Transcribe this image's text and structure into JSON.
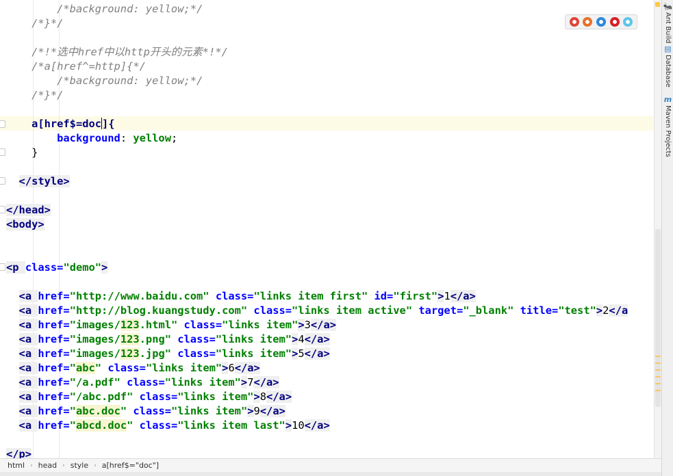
{
  "editor": {
    "lines": [
      [
        {
          "t": "        "
        },
        {
          "t": "/*background: yellow;*/",
          "c": "cm"
        }
      ],
      [
        {
          "t": "    "
        },
        {
          "t": "/*}*/",
          "c": "cm"
        }
      ],
      [],
      [
        {
          "t": "    "
        },
        {
          "t": "/*!*选中href中以http开头的元素*!*/",
          "c": "cm"
        }
      ],
      [
        {
          "t": "    "
        },
        {
          "t": "/*a[href^=http]{*/",
          "c": "cm"
        }
      ],
      [
        {
          "t": "        "
        },
        {
          "t": "/*background: yellow;*/",
          "c": "cm"
        }
      ],
      [
        {
          "t": "    "
        },
        {
          "t": "/*}*/",
          "c": "cm"
        }
      ],
      [],
      [
        {
          "t": "    "
        },
        {
          "t": "a[href$=doc",
          "c": "sel"
        },
        {
          "t": "|",
          "c": "caret"
        },
        {
          "t": "]{",
          "c": "sel"
        }
      ],
      [
        {
          "t": "        "
        },
        {
          "t": "background",
          "c": "pn"
        },
        {
          "t": ": "
        },
        {
          "t": "yellow",
          "c": "pv"
        },
        {
          "t": ";"
        }
      ],
      [
        {
          "t": "    "
        },
        {
          "t": "}"
        }
      ],
      [],
      [
        {
          "t": "  "
        },
        {
          "t": "</style>",
          "c": "tg"
        }
      ],
      [],
      [
        {
          "t": "</head>",
          "c": "tg"
        }
      ],
      [
        {
          "t": "<body>",
          "c": "tg"
        }
      ],
      [],
      [],
      [
        {
          "t": "<p ",
          "c": "tg"
        },
        {
          "t": "class",
          "c": "an"
        },
        {
          "t": "=",
          "c": "an"
        },
        {
          "t": "\"demo\"",
          "c": "av"
        },
        {
          "t": ">",
          "c": "tg"
        }
      ],
      [],
      [
        {
          "t": "  "
        },
        {
          "t": "<a ",
          "c": "tg"
        },
        {
          "t": "href=",
          "c": "an"
        },
        {
          "t": "\"http://www.baidu.com\"",
          "c": "av"
        },
        {
          "t": " class=",
          "c": "an"
        },
        {
          "t": "\"links item first\"",
          "c": "av"
        },
        {
          "t": " id=",
          "c": "an"
        },
        {
          "t": "\"first\"",
          "c": "av"
        },
        {
          "t": ">",
          "c": "tg"
        },
        {
          "t": "1"
        },
        {
          "t": "</a>",
          "c": "tg"
        }
      ],
      [
        {
          "t": "  "
        },
        {
          "t": "<a ",
          "c": "tg"
        },
        {
          "t": "href=",
          "c": "an"
        },
        {
          "t": "\"http://blog.kuangstudy.com\"",
          "c": "av"
        },
        {
          "t": " class=",
          "c": "an"
        },
        {
          "t": "\"links item active\"",
          "c": "av"
        },
        {
          "t": " target=",
          "c": "an"
        },
        {
          "t": "\"_blank\"",
          "c": "av"
        },
        {
          "t": " title=",
          "c": "an"
        },
        {
          "t": "\"test\"",
          "c": "av"
        },
        {
          "t": ">",
          "c": "tg"
        },
        {
          "t": "2"
        },
        {
          "t": "</a",
          "c": "tg"
        }
      ],
      [
        {
          "t": "  "
        },
        {
          "t": "<a ",
          "c": "tg"
        },
        {
          "t": "href=",
          "c": "an"
        },
        {
          "t": "\"images/",
          "c": "av"
        },
        {
          "t": "123",
          "c": "av hl"
        },
        {
          "t": ".html\"",
          "c": "av"
        },
        {
          "t": " class=",
          "c": "an"
        },
        {
          "t": "\"links item\"",
          "c": "av"
        },
        {
          "t": ">",
          "c": "tg"
        },
        {
          "t": "3"
        },
        {
          "t": "</a>",
          "c": "tg"
        }
      ],
      [
        {
          "t": "  "
        },
        {
          "t": "<a ",
          "c": "tg"
        },
        {
          "t": "href=",
          "c": "an"
        },
        {
          "t": "\"images/",
          "c": "av"
        },
        {
          "t": "123",
          "c": "av hl"
        },
        {
          "t": ".png\"",
          "c": "av"
        },
        {
          "t": " class=",
          "c": "an"
        },
        {
          "t": "\"links item\"",
          "c": "av"
        },
        {
          "t": ">",
          "c": "tg"
        },
        {
          "t": "4"
        },
        {
          "t": "</a>",
          "c": "tg"
        }
      ],
      [
        {
          "t": "  "
        },
        {
          "t": "<a ",
          "c": "tg"
        },
        {
          "t": "href=",
          "c": "an"
        },
        {
          "t": "\"images/",
          "c": "av"
        },
        {
          "t": "123",
          "c": "av hl"
        },
        {
          "t": ".jpg\"",
          "c": "av"
        },
        {
          "t": " class=",
          "c": "an"
        },
        {
          "t": "\"links item\"",
          "c": "av"
        },
        {
          "t": ">",
          "c": "tg"
        },
        {
          "t": "5"
        },
        {
          "t": "</a>",
          "c": "tg"
        }
      ],
      [
        {
          "t": "  "
        },
        {
          "t": "<a ",
          "c": "tg"
        },
        {
          "t": "href=",
          "c": "an"
        },
        {
          "t": "\"",
          "c": "av"
        },
        {
          "t": "abc",
          "c": "av hl"
        },
        {
          "t": "\"",
          "c": "av"
        },
        {
          "t": " class=",
          "c": "an"
        },
        {
          "t": "\"links item\"",
          "c": "av"
        },
        {
          "t": ">",
          "c": "tg"
        },
        {
          "t": "6"
        },
        {
          "t": "</a>",
          "c": "tg"
        }
      ],
      [
        {
          "t": "  "
        },
        {
          "t": "<a ",
          "c": "tg"
        },
        {
          "t": "href=",
          "c": "an"
        },
        {
          "t": "\"/a.pdf\"",
          "c": "av"
        },
        {
          "t": " class=",
          "c": "an"
        },
        {
          "t": "\"links item\"",
          "c": "av"
        },
        {
          "t": ">",
          "c": "tg"
        },
        {
          "t": "7"
        },
        {
          "t": "</a>",
          "c": "tg"
        }
      ],
      [
        {
          "t": "  "
        },
        {
          "t": "<a ",
          "c": "tg"
        },
        {
          "t": "href=",
          "c": "an"
        },
        {
          "t": "\"/abc.pdf\"",
          "c": "av"
        },
        {
          "t": " class=",
          "c": "an"
        },
        {
          "t": "\"links item\"",
          "c": "av"
        },
        {
          "t": ">",
          "c": "tg"
        },
        {
          "t": "8"
        },
        {
          "t": "</a>",
          "c": "tg"
        }
      ],
      [
        {
          "t": "  "
        },
        {
          "t": "<a ",
          "c": "tg"
        },
        {
          "t": "href=",
          "c": "an"
        },
        {
          "t": "\"",
          "c": "av"
        },
        {
          "t": "abc.doc",
          "c": "av hl"
        },
        {
          "t": "\"",
          "c": "av"
        },
        {
          "t": " class=",
          "c": "an"
        },
        {
          "t": "\"links item\"",
          "c": "av"
        },
        {
          "t": ">",
          "c": "tg"
        },
        {
          "t": "9"
        },
        {
          "t": "</a>",
          "c": "tg"
        }
      ],
      [
        {
          "t": "  "
        },
        {
          "t": "<a ",
          "c": "tg"
        },
        {
          "t": "href=",
          "c": "an"
        },
        {
          "t": "\"",
          "c": "av"
        },
        {
          "t": "abcd.doc",
          "c": "av hl"
        },
        {
          "t": "\"",
          "c": "av"
        },
        {
          "t": " class=",
          "c": "an"
        },
        {
          "t": "\"links item last\"",
          "c": "av"
        },
        {
          "t": ">",
          "c": "tg"
        },
        {
          "t": "10"
        },
        {
          "t": "</a>",
          "c": "tg"
        }
      ],
      [],
      [
        {
          "t": "</p>",
          "c": "tg"
        }
      ]
    ]
  },
  "browsers": [
    {
      "name": "chrome-icon",
      "color": "#e0453a"
    },
    {
      "name": "firefox-icon",
      "color": "#e8702a"
    },
    {
      "name": "safari-icon",
      "color": "#2d88d8"
    },
    {
      "name": "opera-icon",
      "color": "#d61f2a"
    },
    {
      "name": "ie-icon",
      "color": "#5ec5e8"
    }
  ],
  "right_tools": [
    {
      "name": "ant-build",
      "label": "Ant Build",
      "icon": "🐜"
    },
    {
      "name": "database",
      "label": "Database",
      "icon": "▤"
    },
    {
      "name": "maven-projects",
      "label": "Maven Projects",
      "icon": "m"
    }
  ],
  "breadcrumb": [
    "html",
    "head",
    "style",
    "a[href$=\"doc\"]"
  ]
}
